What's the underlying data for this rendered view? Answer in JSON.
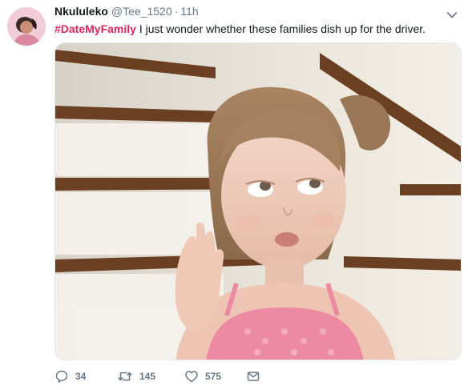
{
  "user": {
    "display_name": "Nkululeko",
    "handle": "@Tee_1520",
    "separator": "·",
    "time_ago": "11h"
  },
  "tweet": {
    "hashtag": "#DateMyFamily",
    "text": " I just wonder whether these families dish up for the driver."
  },
  "stats": {
    "replies": "34",
    "retweets": "145",
    "likes": "575"
  },
  "icons": {
    "reply": "reply-icon",
    "retweet": "retweet-icon",
    "like": "heart-icon",
    "dm": "envelope-icon",
    "menu": "chevron-down-icon"
  },
  "colors": {
    "hashtag": "#e0245e",
    "muted": "#657786",
    "text": "#14171a"
  }
}
